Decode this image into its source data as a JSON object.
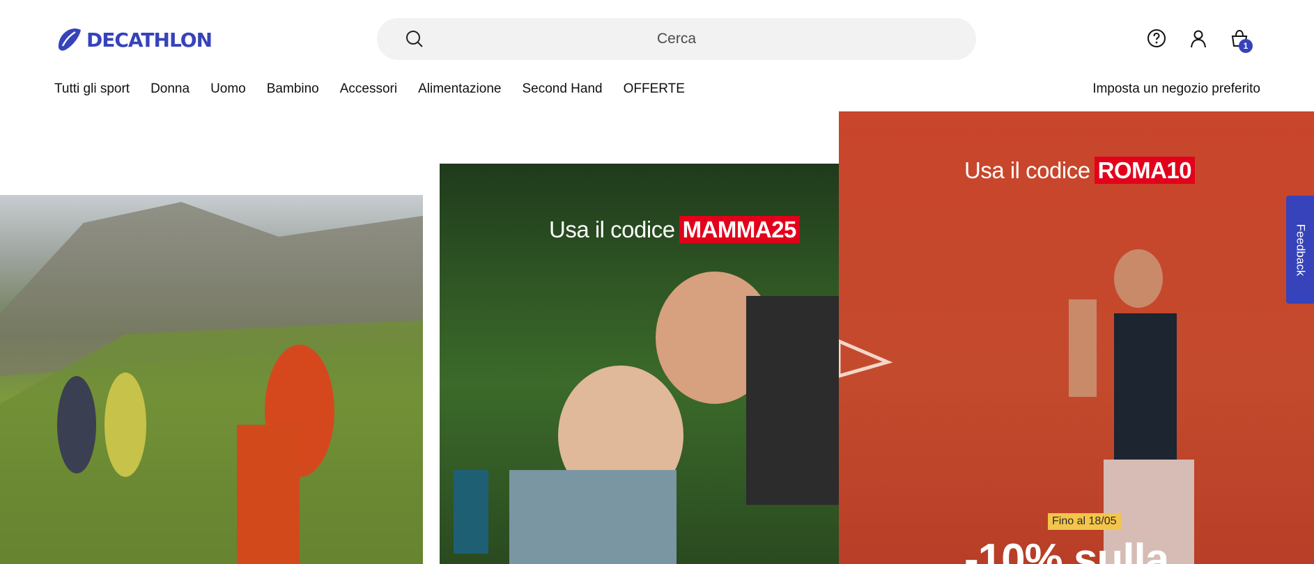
{
  "brand": {
    "name": "DECATHLON",
    "color": "#3643ba"
  },
  "search": {
    "placeholder": "Cerca"
  },
  "header_icons": {
    "help": "help-circle-icon",
    "account": "user-icon",
    "cart": "shopping-bag-icon",
    "cart_count": "1"
  },
  "nav": {
    "items": [
      "Tutti gli sport",
      "Donna",
      "Uomo",
      "Bambino",
      "Accessori",
      "Alimentazione",
      "Second Hand",
      "OFFERTE"
    ],
    "store_link": "Imposta un negozio preferito"
  },
  "promos": {
    "mom": {
      "prefix": "Usa il codice",
      "code": "MAMMA25"
    },
    "tennis": {
      "prefix": "Usa il codice",
      "code": "ROMA10",
      "badge": "Fino al 18/05",
      "headline": "-10% sulla"
    }
  },
  "feedback": {
    "label": "Feedback"
  },
  "colors": {
    "accent": "#3643ba",
    "code_bg": "#e3001b",
    "badge_bg": "#f4c54a",
    "clay": "#c9452b"
  }
}
